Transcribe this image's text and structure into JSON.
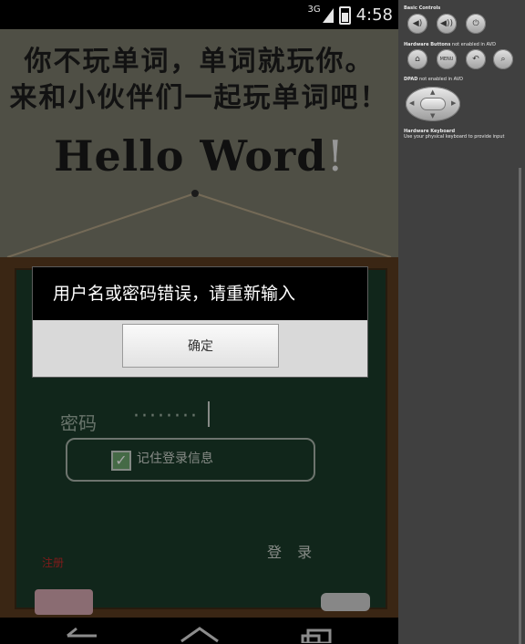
{
  "status_bar": {
    "network": "3G",
    "time": "4:58"
  },
  "app": {
    "slogan_line1": "你不玩单词，单词就玩你。",
    "slogan_line2": "来和小伙伴们一起玩单词吧！",
    "hello_text": "Hello Word",
    "hello_excl": "!",
    "password_label": "密码",
    "password_value": "········",
    "remember_label": "记住登录信息",
    "login_button": "登 录",
    "register_link": "注册"
  },
  "dialog": {
    "message": "用户名或密码错误，请重新输入",
    "ok_button": "确定"
  },
  "side_panel": {
    "basic_controls": "Basic Controls",
    "hardware_buttons": "Hardware Buttons",
    "hardware_buttons_note": "not enabled in AVD",
    "dpad": "DPAD",
    "dpad_note": "not enabled in AVD",
    "hardware_keyboard": "Hardware Keyboard",
    "hardware_keyboard_note": "Use your physical keyboard to provide input",
    "menu_button": "MENU"
  }
}
